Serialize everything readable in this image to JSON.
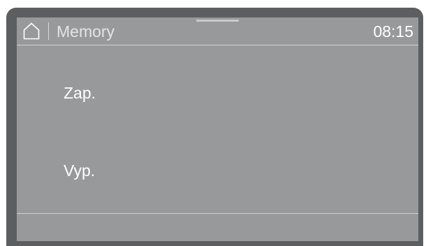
{
  "header": {
    "title": "Memory",
    "time": "08:15",
    "home_icon": "home-icon"
  },
  "options": {
    "on_label": "Zap.",
    "off_label": "Vyp."
  },
  "colors": {
    "frame": "#5d5e60",
    "screen": "#98999b",
    "text": "#ffffff"
  }
}
